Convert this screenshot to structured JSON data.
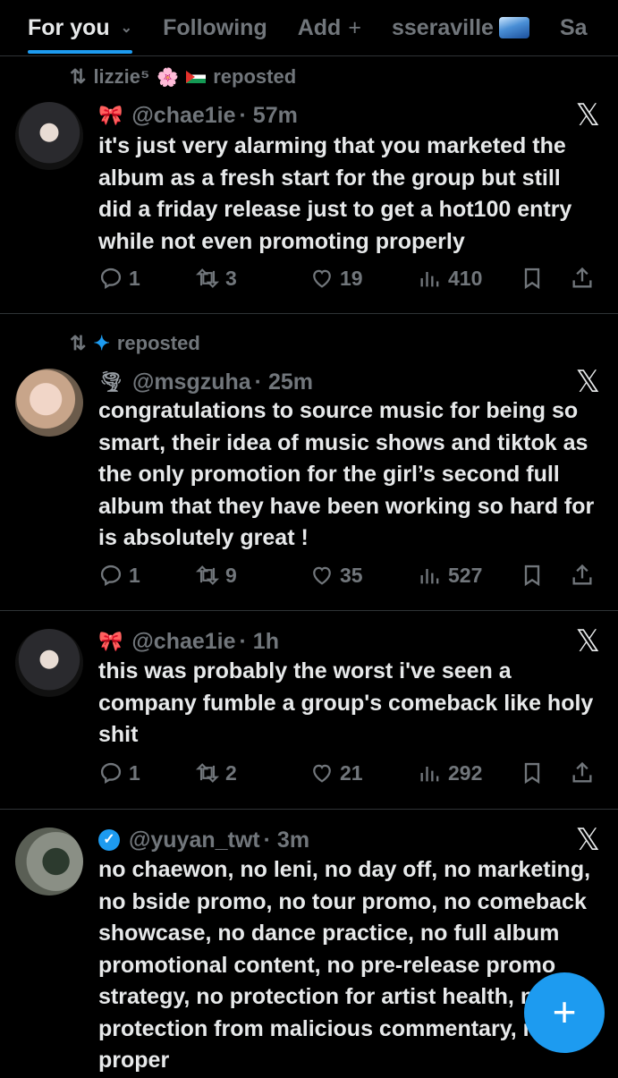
{
  "tabs": [
    {
      "label": "For you"
    },
    {
      "label": "Following"
    },
    {
      "label": "Add"
    },
    {
      "label": "sseraville"
    },
    {
      "label": "Sa"
    }
  ],
  "tab_icons": {
    "for_you": "chevron-down-icon",
    "add": "plus-icon",
    "sseraville": "wave-icon"
  },
  "posts": [
    {
      "repost_by": "lizzie⁵",
      "repost_suffix": "reposted",
      "handle": "@chae1ie",
      "time": "· 57m",
      "text": "it's just very alarming that you marketed the album as a fresh start for the group but still did a friday release just to get a hot100 entry while not even promoting properly",
      "replies": "1",
      "reposts": "3",
      "likes": "19",
      "views": "410"
    },
    {
      "repost_by": "",
      "repost_suffix": "reposted",
      "handle": "@msgzuha",
      "time": "· 25m",
      "text": "congratulations to source music for being so smart, their idea of music shows and tiktok as the only promotion for the girl’s second full album that they have been working so hard for is absolutely great !",
      "replies": "1",
      "reposts": "9",
      "likes": "35",
      "views": "527"
    },
    {
      "handle": "@chae1ie",
      "time": "· 1h",
      "text": "this was probably the worst i've seen a company fumble a group's comeback like holy shit",
      "replies": "1",
      "reposts": "2",
      "likes": "21",
      "views": "292"
    },
    {
      "handle": "@yuyan_twt",
      "time": "· 3m",
      "text": "no chaewon, no leni, no day off, no marketing, no bside promo, no tour promo, no comeback showcase, no dance practice, no full album promotional content, no pre-release promo strategy, no protection for artist health, no protection from malicious commentary, no proper"
    }
  ],
  "fab": {
    "label": "+"
  },
  "colors": {
    "accent": "#1d9bf0",
    "muted": "#71767b",
    "text": "#e7e9ea",
    "divider": "#2f3336"
  }
}
